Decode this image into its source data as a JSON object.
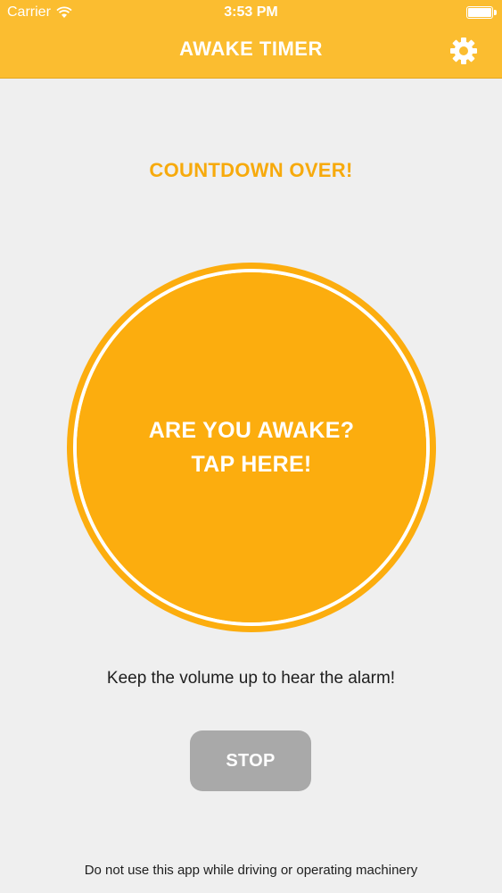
{
  "status_bar": {
    "carrier": "Carrier",
    "time": "3:53 PM",
    "wifi_icon": "wifi-icon",
    "battery_icon": "battery-icon"
  },
  "nav": {
    "title": "AWAKE TIMER",
    "settings_icon": "gear-icon"
  },
  "main": {
    "status_text": "COUNTDOWN OVER!",
    "circle_line1": "ARE YOU AWAKE?",
    "circle_line2": "TAP HERE!",
    "volume_note": "Keep the volume up to hear the alarm!",
    "stop_label": "STOP",
    "disclaimer": "Do not use this app while driving or operating machinery"
  },
  "colors": {
    "accent": "#fbbd30",
    "circle": "#fcad0e",
    "countdown_text": "#f7aa0c",
    "stop_button": "#a9a9a9",
    "background": "#efefef"
  }
}
